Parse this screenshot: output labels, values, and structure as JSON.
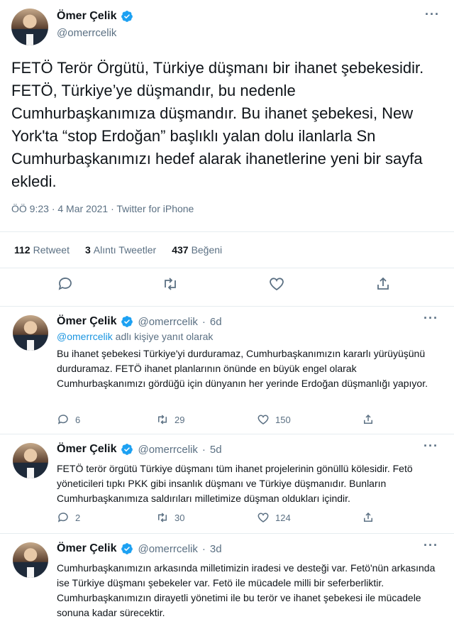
{
  "main_tweet": {
    "author_name": "Ömer Çelik",
    "author_handle": "@omerrcelik",
    "text": "FETÖ Terör Örgütü, Türkiye düşmanı bir ihanet şebekesidir. FETÖ, Türkiye’ye düşmandır, bu nedenle Cumhurbaşkanımıza düşmandır. Bu ihanet şebekesi, New York'ta “stop Erdoğan” başlıklı yalan dolu ilanlarla Sn Cumhurbaşkanımızı hedef alarak ihanetlerine yeni bir sayfa ekledi.",
    "time": "ÖÖ 9:23",
    "date": "4 Mar 2021",
    "source": "Twitter for iPhone",
    "stats": {
      "retweets_count": "112",
      "retweets_label": "Retweet",
      "quotes_count": "3",
      "quotes_label": "Alıntı Tweetler",
      "likes_count": "437",
      "likes_label": "Beğeni"
    }
  },
  "replies": [
    {
      "author_name": "Ömer Çelik",
      "author_handle": "@omerrcelik",
      "age": "6d",
      "replying_to_handle": "@omerrcelik",
      "replying_to_suffix": "adlı kişiye yanıt olarak",
      "text": "Bu ihanet şebekesi Türkiye'yi durduramaz, Cumhurbaşkanımızın kararlı yürüyüşünü durduramaz. FETÖ ihanet planlarının önünde en büyük engel olarak Cumhurbaşkanımızı gördüğü için dünyanın her yerinde Erdoğan düşmanlığı yapıyor.",
      "reply_count": "6",
      "retweet_count": "29",
      "like_count": "150"
    },
    {
      "author_name": "Ömer Çelik",
      "author_handle": "@omerrcelik",
      "age": "5d",
      "text": "FETÖ terör örgütü Türkiye düşmanı tüm ihanet projelerinin gönüllü kölesidir. Fetö yöneticileri tıpkı PKK gibi insanlık düşmanı ve Türkiye düşmanıdır. Bunların Cumhurbaşkanımıza saldırıları milletimize düşman oldukları içindir.",
      "reply_count": "2",
      "retweet_count": "30",
      "like_count": "124"
    },
    {
      "author_name": "Ömer Çelik",
      "author_handle": "@omerrcelik",
      "age": "3d",
      "text": "Cumhurbaşkanımızın arkasında milletimizin iradesi ve desteği var. Fetö'nün arkasında ise Türkiye düşmanı şebekeler var. Fetö ile mücadele milli bir seferberliktir. Cumhurbaşkanımızın dirayetli yönetimi ile bu terör ve ihanet şebekesi ile mücadele sonuna kadar sürecektir."
    }
  ],
  "icons": {
    "verified": "verified-badge-icon",
    "reply": "reply-bubble-icon",
    "retweet": "retweet-icon",
    "like": "heart-icon",
    "share": "share-icon",
    "more": "more-dots-icon"
  },
  "colors": {
    "verified": "#1da1f2",
    "secondary_text": "#5b7083",
    "link": "#1b95e0",
    "divider": "#e6ecf0"
  }
}
